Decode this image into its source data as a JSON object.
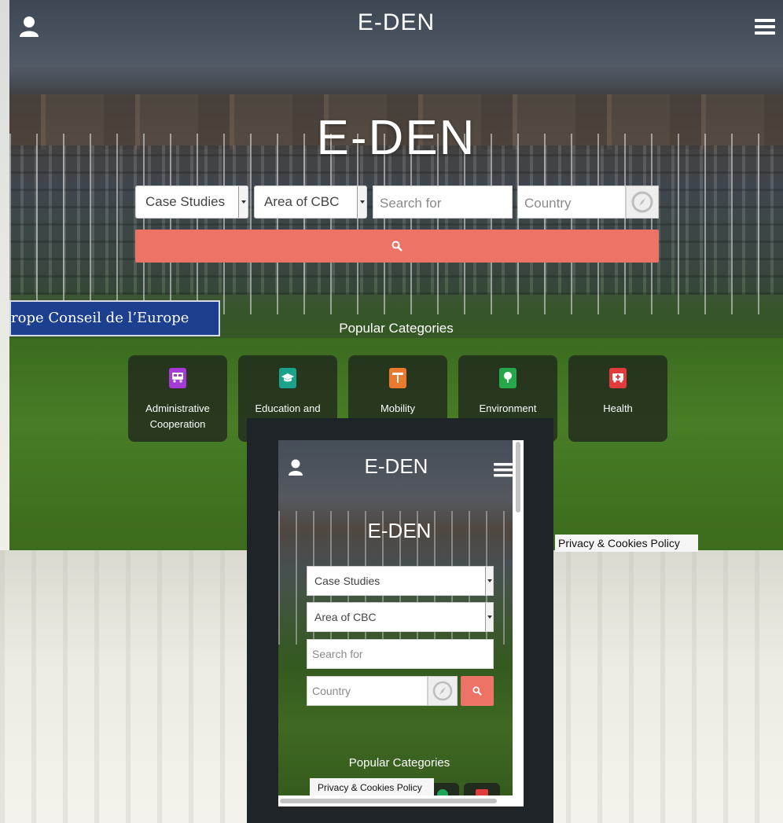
{
  "desktop": {
    "header_title": "E-DEN",
    "hero_title": "E-DEN",
    "sign_text": "rope  Conseil de l’Europe",
    "filters": {
      "type_select": "Case Studies",
      "area_select": "Area of CBC",
      "search_placeholder": "Search for",
      "country_placeholder": "Country"
    },
    "popular_heading": "Popular Categories",
    "categories": [
      {
        "label": "Administrative Cooperation",
        "color": "#a53ad6",
        "icon": "bus-icon"
      },
      {
        "label": "Education and",
        "color": "#1aa38a",
        "icon": "graduation-cap-icon"
      },
      {
        "label": "Mobility",
        "color": "#ea7b2e",
        "icon": "road-sign-icon"
      },
      {
        "label": "Environment",
        "color": "#25a84a",
        "icon": "tree-icon"
      },
      {
        "label": "Health",
        "color": "#e23b3b",
        "icon": "ambulance-icon"
      }
    ],
    "privacy_link": "Privacy & Cookies Policy",
    "accent_color": "#ec7365"
  },
  "mobile": {
    "header_title": "E-DEN",
    "hero_title": "E-DEN",
    "filters": {
      "type_select": "Case Studies",
      "area_select": "Area of CBC",
      "search_placeholder": "Search for",
      "country_placeholder": "Country"
    },
    "popular_heading": "Popular Categories",
    "privacy_link": "Privacy & Cookies Policy"
  }
}
